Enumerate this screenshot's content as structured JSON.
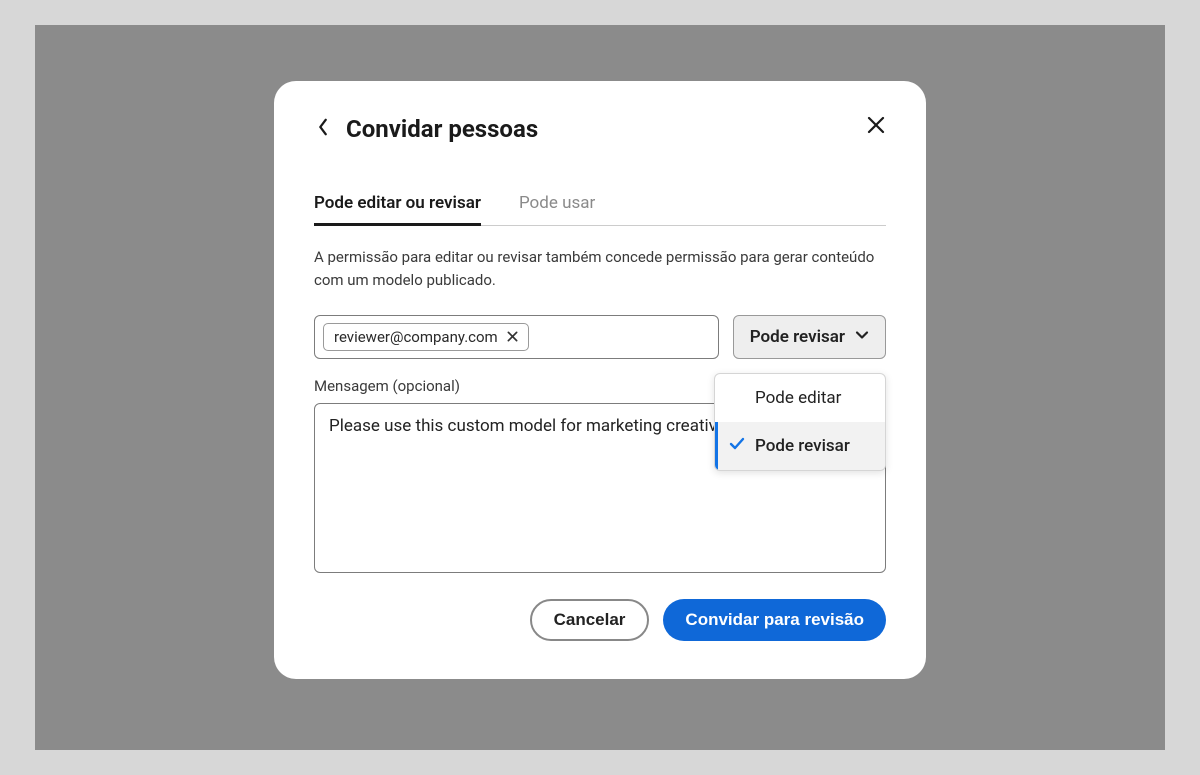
{
  "dialog": {
    "title": "Convidar pessoas"
  },
  "tabs": {
    "edit_review": "Pode editar ou revisar",
    "use": "Pode usar"
  },
  "description": "A permissão para editar ou revisar também concede permissão para gerar conteúdo com um modelo publicado.",
  "email_chip": "reviewer@company.com",
  "permission_select": {
    "label": "Pode revisar",
    "options": {
      "edit": "Pode editar",
      "review": "Pode revisar"
    }
  },
  "message": {
    "label": "Mensagem (opcional)",
    "value": "Please use this custom model for marketing creative."
  },
  "buttons": {
    "cancel": "Cancelar",
    "invite": "Convidar para revisão"
  }
}
